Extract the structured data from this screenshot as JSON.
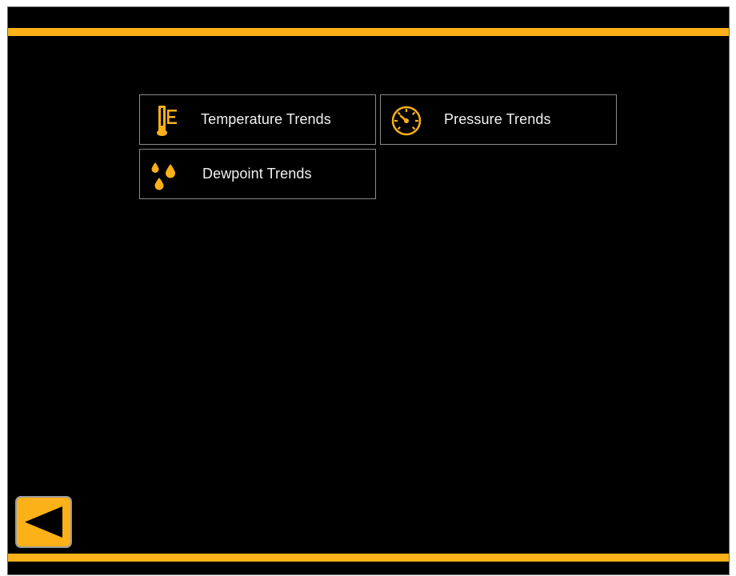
{
  "menu": {
    "items": [
      {
        "label": "Temperature Trends",
        "icon": "thermometer-icon"
      },
      {
        "label": "Pressure Trends",
        "icon": "gauge-icon"
      },
      {
        "label": "Dewpoint Trends",
        "icon": "droplets-icon"
      }
    ]
  },
  "navigation": {
    "back_icon": "back-arrow-icon"
  },
  "colors": {
    "accent": "#fbb117",
    "background": "#000000",
    "tile_border": "#8a8a8a",
    "text": "#f2f2f2"
  }
}
